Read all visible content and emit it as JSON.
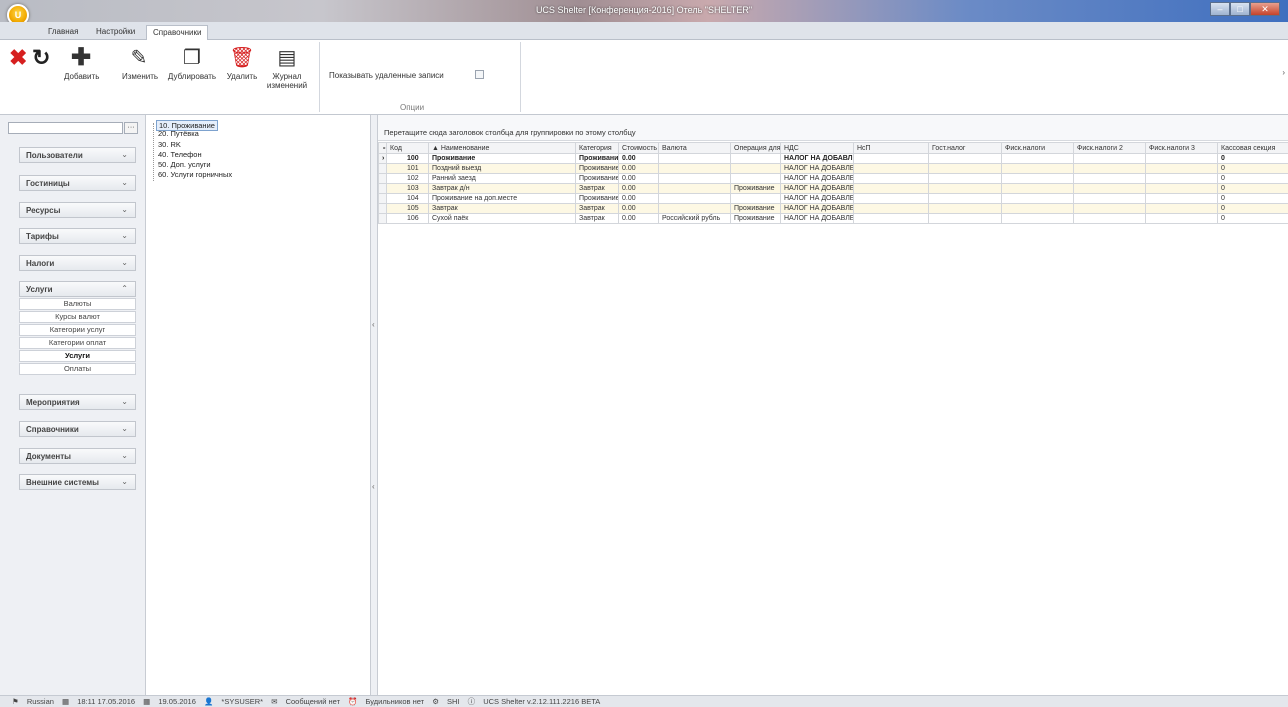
{
  "window": {
    "title": "UCS Shelter [Конференция-2016] Отель \"SHELTER\"",
    "logo_text": "U"
  },
  "ribbon_tabs": [
    {
      "label": "Главная",
      "active": false
    },
    {
      "label": "Настройки",
      "active": false
    },
    {
      "label": "Справочники",
      "active": true
    }
  ],
  "toolbar": {
    "close_icon": "red-x-icon",
    "refresh_icon": "refresh-icon",
    "add_label": "Добавить",
    "edit_label": "Изменить",
    "duplicate_label": "Дублировать",
    "delete_label": "Удалить",
    "journal_label": "Журнал изменений",
    "show_deleted_label": "Показывать удаленные записи",
    "show_deleted_checked": false,
    "options_group_title": "Опции"
  },
  "nav": {
    "groups": [
      {
        "label": "Пользователи",
        "expanded": false
      },
      {
        "label": "Гостиницы",
        "expanded": false
      },
      {
        "label": "Ресурсы",
        "expanded": false
      },
      {
        "label": "Тарифы",
        "expanded": false
      },
      {
        "label": "Налоги",
        "expanded": false
      },
      {
        "label": "Услуги",
        "expanded": true
      },
      {
        "label": "Мероприятия",
        "expanded": false
      },
      {
        "label": "Справочники",
        "expanded": false
      },
      {
        "label": "Документы",
        "expanded": false
      },
      {
        "label": "Внешние системы",
        "expanded": false
      }
    ],
    "services_items": [
      {
        "label": "Валюты",
        "selected": false
      },
      {
        "label": "Курсы валют",
        "selected": false
      },
      {
        "label": "Категории услуг",
        "selected": false
      },
      {
        "label": "Категории оплат",
        "selected": false
      },
      {
        "label": "Услуги",
        "selected": true
      },
      {
        "label": "Оплаты",
        "selected": false
      }
    ]
  },
  "tree": {
    "nodes": [
      {
        "label": "10. Проживание",
        "selected": true
      },
      {
        "label": "20. Путёвка",
        "selected": false
      },
      {
        "label": "30. RK",
        "selected": false
      },
      {
        "label": "40. Телефон",
        "selected": false
      },
      {
        "label": "50. Доп. услуги",
        "selected": false
      },
      {
        "label": "60. Услуги горничных",
        "selected": false
      }
    ]
  },
  "grid": {
    "group_hint": "Перетащите сюда заголовок столбца для группировки по этому столбцу",
    "columns": [
      "Код",
      "Наименование",
      "Категория",
      "Стоимость",
      "Валюта",
      "Операция для",
      "НДС",
      "НсП",
      "Гост.налог",
      "Фиск.налоги",
      "Фиск.налоги 2",
      "Фиск.налоги 3",
      "Кассовая секция"
    ],
    "rows": [
      [
        "100",
        "Проживание",
        "Проживание",
        "0.00",
        "",
        "",
        "НАЛОГ НА ДОБАВЛЕ",
        "",
        "",
        "",
        "",
        "",
        "0"
      ],
      [
        "101",
        "Поздний выезд",
        "Проживание",
        "0.00",
        "",
        "",
        "НАЛОГ НА ДОБАВЛЕ",
        "",
        "",
        "",
        "",
        "",
        "0"
      ],
      [
        "102",
        "Ранний заезд",
        "Проживание",
        "0.00",
        "",
        "",
        "НАЛОГ НА ДОБАВЛЕ",
        "",
        "",
        "",
        "",
        "",
        "0"
      ],
      [
        "103",
        "Завтрак д/н",
        "Завтрак",
        "0.00",
        "",
        "Проживание",
        "НАЛОГ НА ДОБАВЛЕ",
        "",
        "",
        "",
        "",
        "",
        "0"
      ],
      [
        "104",
        "Проживание на доп.месте",
        "Проживание",
        "0.00",
        "",
        "",
        "НАЛОГ НА ДОБАВЛЕ",
        "",
        "",
        "",
        "",
        "",
        "0"
      ],
      [
        "105",
        "Завтрак",
        "Завтрак",
        "0.00",
        "",
        "Проживание",
        "НАЛОГ НА ДОБАВЛЕ",
        "",
        "",
        "",
        "",
        "",
        "0"
      ],
      [
        "106",
        "Сухой паёк",
        "Завтрак",
        "0.00",
        "Российский рубль",
        "Проживание",
        "НАЛОГ НА ДОБАВЛЕ",
        "",
        "",
        "",
        "",
        "",
        "0"
      ]
    ]
  },
  "status": {
    "language": "Russian",
    "datetime": "18:11 17.05.2016",
    "date": "19.05.2016",
    "user": "*SYSUSER*",
    "messages": "Сообщений нет",
    "alarms": "Будильников нет",
    "station": "SHI",
    "version": "UCS Shelter v.2.12.111.2216 BETA"
  }
}
